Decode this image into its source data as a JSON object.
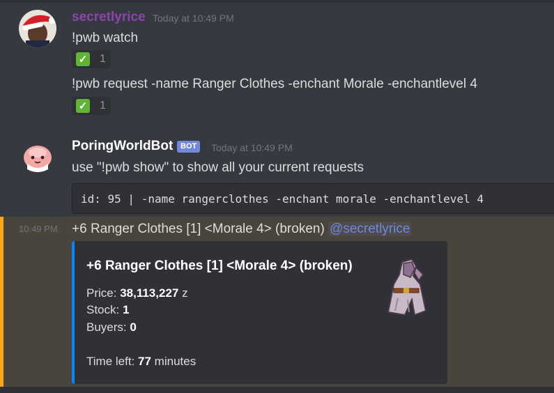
{
  "messages": [
    {
      "username": "secretlyrice",
      "username_color": "#8e44ad",
      "timestamp": "Today at 10:49 PM",
      "lines": [
        "!pwb watch",
        "!pwb request -name Ranger Clothes -enchant Morale -enchantlevel 4"
      ],
      "reactions": [
        {
          "icon": "check-mark-icon",
          "count": "1"
        },
        {
          "icon": "check-mark-icon",
          "count": "1"
        }
      ]
    },
    {
      "username": "PoringWorldBot",
      "username_color": "#ffffff",
      "bot_tag": "BOT",
      "timestamp": "Today at 10:49 PM",
      "text": "use \"!pwb show\" to show all your current requests",
      "code": "id: 95 | -name rangerclothes -enchant morale -enchantlevel 4"
    },
    {
      "timestamp": "10:49 PM",
      "text": "+6 Ranger Clothes [1] <Morale 4> (broken)",
      "mention": "@secretlyrice",
      "embed": {
        "title": "+6 Ranger Clothes [1] <Morale 4> (broken)",
        "price_label": "Price:",
        "price_value": "38,113,227",
        "price_unit": "z",
        "stock_label": "Stock:",
        "stock_value": "1",
        "buyers_label": "Buyers:",
        "buyers_value": "0",
        "time_label": "Time left:",
        "time_value": "77",
        "time_unit": "minutes",
        "accent_color": "#0a84ff",
        "thumbnail_icon": "ranger-clothes-item-icon"
      }
    }
  ],
  "colors": {
    "background": "#36393f",
    "highlight": "#49443c",
    "highlight_bar": "#faa61a",
    "mention": "#7289da"
  }
}
